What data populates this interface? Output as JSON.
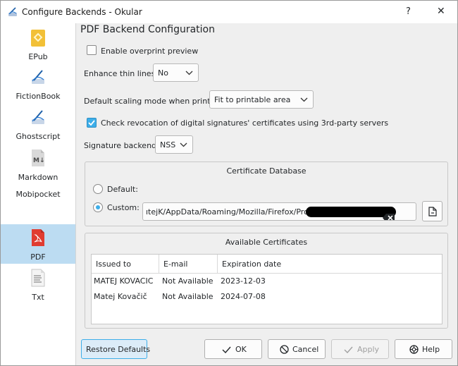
{
  "window": {
    "title": "Configure Backends - Okular",
    "help_glyph": "?",
    "close_glyph": "✕"
  },
  "sidebar": {
    "items": [
      {
        "label": "EPub",
        "icon": "epub-icon"
      },
      {
        "label": "FictionBook",
        "icon": "okular-icon"
      },
      {
        "label": "Ghostscript",
        "icon": "okular-icon"
      },
      {
        "label": "Markdown",
        "icon": "markdown-icon"
      },
      {
        "label": "Mobipocket",
        "icon": ""
      },
      {
        "label": "PDF",
        "icon": "pdf-icon",
        "selected": true
      },
      {
        "label": "Txt",
        "icon": "text-file-icon"
      }
    ]
  },
  "main": {
    "heading": "PDF Backend Configuration",
    "overprint_label": "Enable overprint preview",
    "overprint_checked": false,
    "thin_lines_label": "Enhance thin lines:",
    "thin_lines_value": "No",
    "scaling_label": "Default scaling mode when printing:",
    "scaling_value": "Fit to printable area",
    "revocation_label": "Check revocation of digital signatures' certificates using 3rd-party servers",
    "revocation_checked": true,
    "sig_backend_label": "Signature backend:",
    "sig_backend_value": "NSS",
    "cert_db": {
      "title": "Certificate Database",
      "default_label": "Default:",
      "custom_label": "Custom:",
      "selected": "custom",
      "path_value": "ıtejK/AppData/Roaming/Mozilla/Firefox/Profiles/"
    },
    "available": {
      "title": "Available Certificates",
      "columns": [
        "Issued to",
        "E-mail",
        "Expiration date"
      ],
      "rows": [
        [
          "MATEJ KOVACIC",
          "Not Available",
          "2023-12-03"
        ],
        [
          "Matej Kovačič",
          "Not Available",
          "2024-07-08"
        ]
      ]
    }
  },
  "buttons": {
    "restore": "Restore Defaults",
    "ok": "OK",
    "cancel": "Cancel",
    "apply": "Apply",
    "help": "Help"
  },
  "colors": {
    "accent": "#3daee9",
    "selection": "#bcdcf2",
    "pdf_red": "#e03c31",
    "epub_yellow": "#f2c037"
  }
}
